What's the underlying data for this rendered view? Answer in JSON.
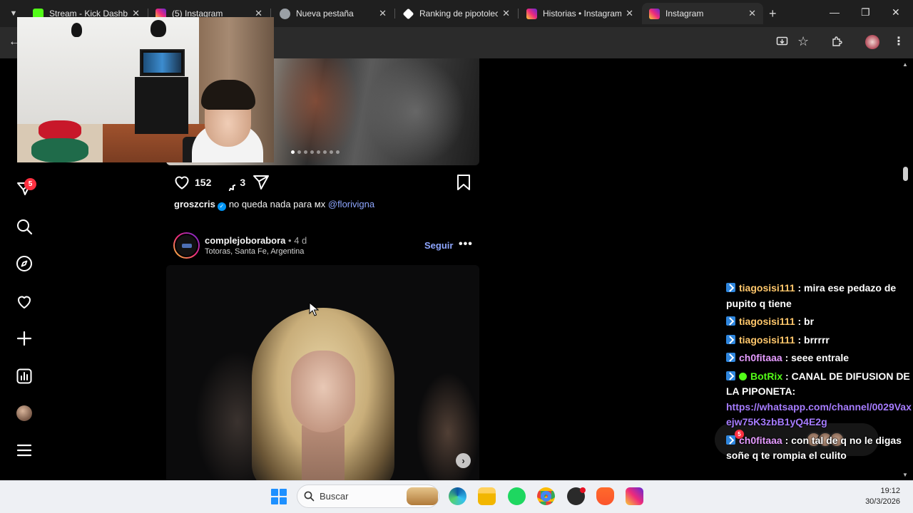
{
  "browser": {
    "tabs": [
      {
        "title": "Stream - Kick Dashbo",
        "favicon_color": "#53fc18",
        "active": false
      },
      {
        "title": "(5) Instagram",
        "favicon_color": "#e1306c",
        "active": false
      },
      {
        "title": "Nueva pestaña",
        "favicon_color": "#9aa0a6",
        "active": false
      },
      {
        "title": "Ranking de pipotolec",
        "favicon_color": "#ffffff",
        "active": false
      },
      {
        "title": "Historias • Instagram",
        "favicon_color": "#e1306c",
        "active": false
      },
      {
        "title": "Instagram",
        "favicon_color": "#e1306c",
        "active": true
      }
    ],
    "new_tab_glyph": "+",
    "window_controls": {
      "minimize": "—",
      "maximize": "❐",
      "close": "✕"
    }
  },
  "sidebar": {
    "items": [
      {
        "name": "messages-icon",
        "badge": "5"
      },
      {
        "name": "search-icon"
      },
      {
        "name": "explore-icon"
      },
      {
        "name": "notifications-heart-icon"
      },
      {
        "name": "create-plus-icon"
      },
      {
        "name": "dashboard-icon"
      },
      {
        "name": "profile-avatar"
      },
      {
        "name": "menu-hamburger-icon"
      }
    ]
  },
  "post1": {
    "likes": "152",
    "comments": "3",
    "caption_user": "groszcris",
    "caption_text": "no queda nada para ᴍx",
    "caption_mention": "@florivigna"
  },
  "post2": {
    "username": "complejoborabora",
    "time": "• 4 d",
    "location": "Totoras, Santa Fe, Argentina",
    "follow_label": "Seguir",
    "more_glyph": "•••"
  },
  "chat": {
    "messages": [
      {
        "user": "tiagosisi111",
        "user_color": "#ffc76b",
        "text": " : mira ese pedazo de pupito q tiene"
      },
      {
        "user": "tiagosisi111",
        "user_color": "#ffc76b",
        "text": " : br"
      },
      {
        "user": "tiagosisi111",
        "user_color": "#ffc76b",
        "text": " : brrrrr"
      },
      {
        "user": "ch0fitaaa",
        "user_color": "#e59bff",
        "text": " : seee entrale"
      },
      {
        "user": "BotRix",
        "user_color": "#53fc18",
        "text": " : CANAL DE DIFUSION DE LA PIPONETA:",
        "link": "https://whatsapp.com/channel/0029Vaxejw75K3zbB1yQ4E2g"
      },
      {
        "user": "ch0fitaaa",
        "user_color": "#e59bff",
        "text": " : con tal de q no le digas soñe q te rompia el culito"
      }
    ],
    "notification_badge": "5"
  },
  "taskbar": {
    "search_placeholder": "Buscar",
    "time": "19:12",
    "date": "30/3/2026"
  },
  "colors": {
    "ig_link": "#8ea6ff",
    "ig_badge": "#ff3040",
    "kick_green": "#53fc18"
  }
}
